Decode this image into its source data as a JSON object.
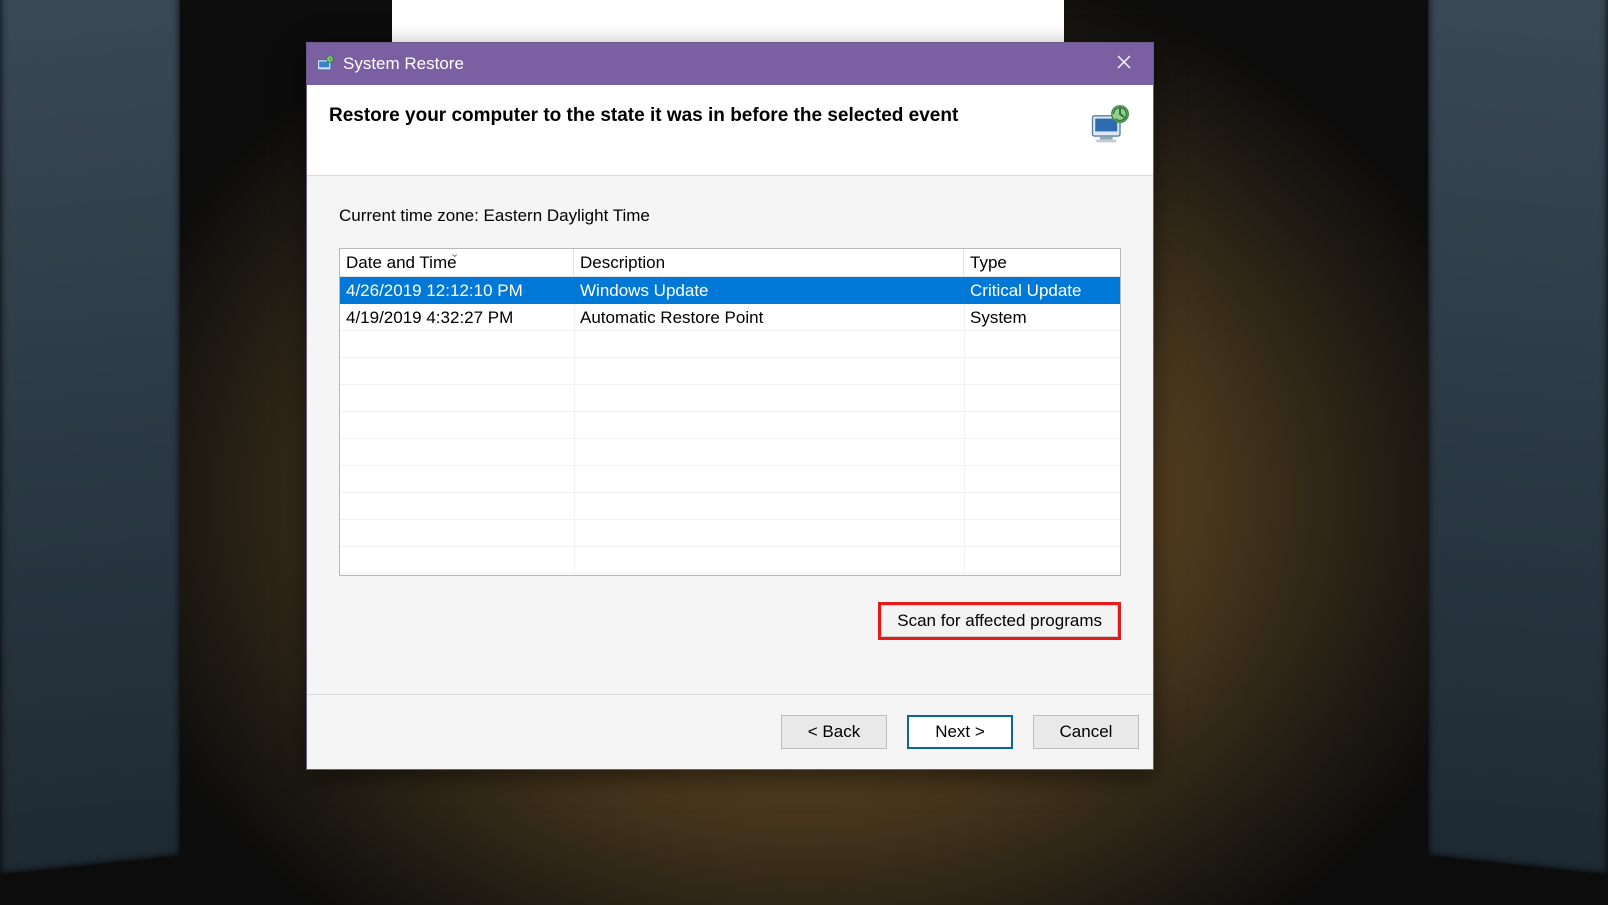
{
  "window": {
    "title": "System Restore"
  },
  "header": {
    "heading": "Restore your computer to the state it was in before the selected event"
  },
  "body": {
    "timezone_label": "Current time zone: Eastern Daylight Time",
    "columns": {
      "date": "Date and Time",
      "desc": "Description",
      "type": "Type"
    },
    "rows": [
      {
        "date": "4/26/2019 12:12:10 PM",
        "desc": "Windows Update",
        "type": "Critical Update",
        "selected": true
      },
      {
        "date": "4/19/2019 4:32:27 PM",
        "desc": "Automatic Restore Point",
        "type": "System",
        "selected": false
      }
    ],
    "scan_label": "Scan for affected programs"
  },
  "footer": {
    "back": "< Back",
    "next": "Next >",
    "cancel": "Cancel"
  }
}
